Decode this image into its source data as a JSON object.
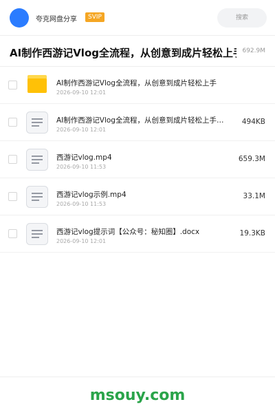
{
  "app": {
    "name": "夸克网盘分享",
    "badge": "SVIP",
    "search_placeholder": "搜索",
    "accent_color": "#2b7cff",
    "badge_color": "#f5a623"
  },
  "share": {
    "title": "AI制作西游记Vlog全流程，从创意到成片轻松上手",
    "total_size": "692.9M"
  },
  "files": [
    {
      "name": "AI制作西游记Vlog全流程，从创意到成片轻松上手",
      "date": "2026-09-10 12:01",
      "size": "",
      "icon": "folder-icon"
    },
    {
      "name": "AI制作西游记Vlog全流程，从创意到成片轻松上手…",
      "date": "2026-09-10 12:01",
      "size": "494KB",
      "icon": "file-icon"
    },
    {
      "name": "西游记vlog.mp4",
      "date": "2026-09-10 11:53",
      "size": "659.3M",
      "icon": "file-icon"
    },
    {
      "name": "西游记vlog示例.mp4",
      "date": "2026-09-10 11:53",
      "size": "33.1M",
      "icon": "file-icon"
    },
    {
      "name": "西游记vlog提示词【公众号：秘知圈】.docx",
      "date": "2026-09-10 12:01",
      "size": "19.3KB",
      "icon": "file-icon"
    }
  ],
  "footer": {
    "watermark": "msouy.com",
    "watermark_color": "#2aa44a"
  }
}
